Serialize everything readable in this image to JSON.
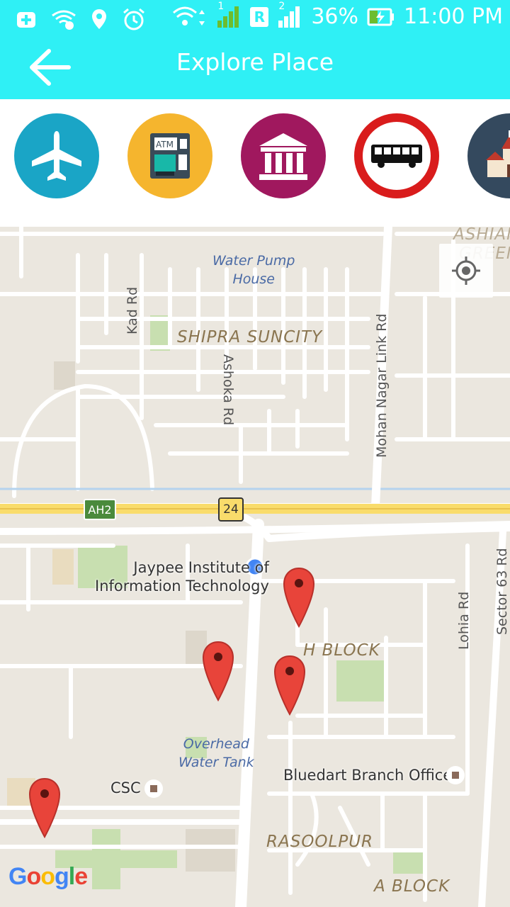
{
  "status_bar": {
    "battery": "36%",
    "time": "11:00 PM",
    "sim1": "1",
    "sim2": "2",
    "roaming": "R"
  },
  "header": {
    "title": "Explore Place"
  },
  "categories": [
    "airport",
    "atm",
    "bank",
    "bus-station",
    "church"
  ],
  "map": {
    "area_labels": [
      "SHIPRA SUNCITY",
      "H BLOCK",
      "RASOOLPUR",
      "A BLOCK",
      "ASHIANA",
      "GREENS"
    ],
    "water_labels": [
      "Water Pump",
      "House",
      "Overhead",
      "Water Tank"
    ],
    "place_labels": [
      "Jaypee Institute of",
      "Information Technology",
      "CSC",
      "Bluedart Branch Office"
    ],
    "road_labels": [
      "Kad Rd",
      "Ashoka Rd",
      "Mohan Nagar Link Rd",
      "Lohia Rd",
      "Sector 63 Rd"
    ],
    "highway_shields": [
      "AH2",
      "24"
    ],
    "logo": "Google",
    "colors": {
      "land": "#ebe7df",
      "road": "#ffffff",
      "highway": "#f9dc6b",
      "park": "#c8dfb0",
      "marker": "#e8443a",
      "current_location": "#4285f4"
    }
  }
}
